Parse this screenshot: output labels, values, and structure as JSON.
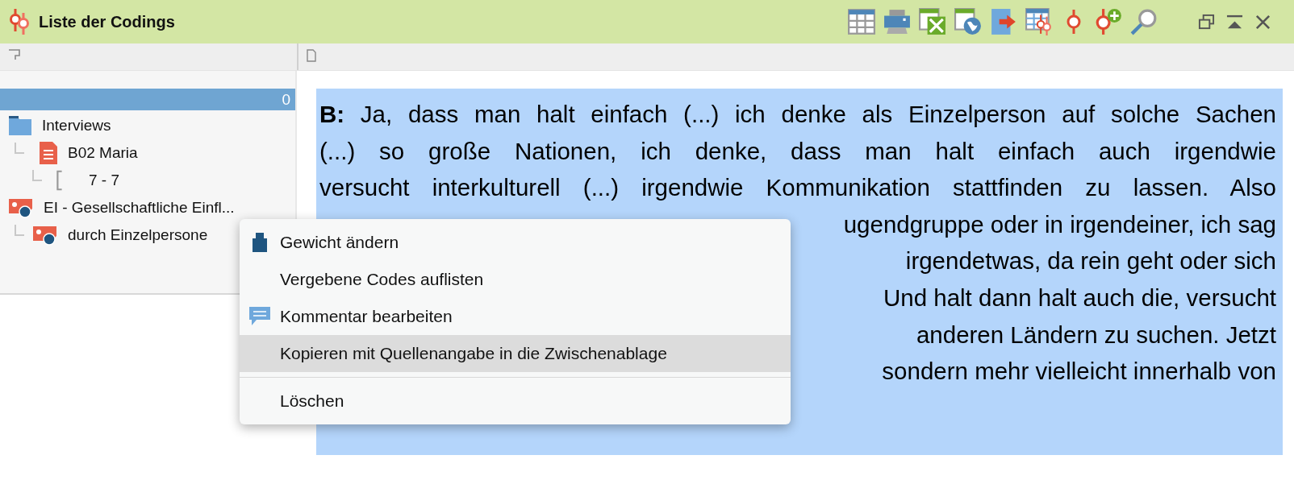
{
  "window": {
    "title": "Liste der Codings"
  },
  "tree": {
    "header_count": "0",
    "items": [
      {
        "label": "Interviews",
        "kind": "folder",
        "children": [
          {
            "label": "B02 Maria",
            "kind": "document",
            "children": [
              {
                "label": "7 - 7",
                "kind": "segment"
              }
            ]
          }
        ]
      },
      {
        "label": "EI - Gesellschaftliche Einfl...",
        "kind": "code",
        "children": [
          {
            "label": "durch Einzelpersone",
            "kind": "code"
          }
        ]
      }
    ]
  },
  "document": {
    "highlighted": true,
    "lines": [
      {
        "kind": "full",
        "text": "**B:** Ja, dass man halt einfach (...) ich denke als Einzelperson auf solche Sachen"
      },
      {
        "kind": "full",
        "text": "(...) so große Nationen, ich denke, dass man halt einfach auch irgendwie"
      },
      {
        "kind": "full",
        "text": "versucht interkulturell (...) irgendwie Kommunikation stattfinden zu lassen. Also"
      },
      {
        "kind": "partial",
        "text": "ugendgruppe oder in irgendeiner, ich sag"
      },
      {
        "kind": "partial",
        "text": "irgendetwas, da rein geht oder sich"
      },
      {
        "kind": "partial",
        "text": "Und halt dann halt auch die, versucht"
      },
      {
        "kind": "partial",
        "text": "anderen Ländern zu suchen. Jetzt"
      },
      {
        "kind": "partial",
        "text": "sondern mehr vielleicht innerhalb von"
      }
    ]
  },
  "context_menu": {
    "items": [
      {
        "kind": "weight",
        "label": "Gewicht ändern",
        "selected": false
      },
      {
        "kind": "plain",
        "label": "Vergebene Codes auflisten",
        "selected": false
      },
      {
        "kind": "comment",
        "label": "Kommentar bearbeiten",
        "selected": false
      },
      {
        "kind": "plain",
        "label": "Kopieren mit Quellenangabe in die Zwischenablage",
        "selected": true
      },
      {
        "kind": "separator"
      },
      {
        "kind": "plain",
        "label": "Löschen",
        "selected": false
      }
    ]
  }
}
